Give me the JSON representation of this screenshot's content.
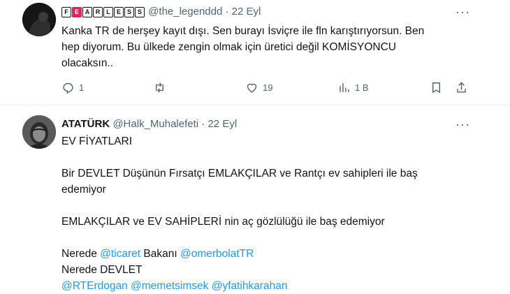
{
  "tweet1": {
    "display_name_badges": [
      "F",
      "E",
      "A",
      "R",
      "L",
      "E",
      "S",
      "S"
    ],
    "handle": "@the_legenddd",
    "separator": "·",
    "date": "22 Eyl",
    "more_icon": "ellipsis-icon",
    "lines": [
      "Kanka TR de herşey kayıt dışı. Sen burayı İsviçre ile fln karıştırıyorsun. Ben",
      "hep diyorum. Bu ülkede zengin olmak için üretici değil KOMİSYONCU",
      "olacaksın.."
    ],
    "actions": {
      "reply_count": "1",
      "retweet_count": "",
      "like_count": "19",
      "views_count": "1 B"
    }
  },
  "tweet2": {
    "display_name": "ATATÜRK",
    "handle": "@Halk_Muhalefeti",
    "separator": "·",
    "date": "22 Eyl",
    "para1": "EV FİYATLARI",
    "para2_line1": "Bir DEVLET Düşünün Fırsatçı EMLAKÇILAR ve Rantçı ev sahipleri ile baş",
    "para2_line2": "edemiyor",
    "para3": "EMLAKÇILAR ve EV SAHİPLERİ nin aç gözlülüğü ile baş edemiyor",
    "line4_prefix": "Nerede",
    "mention_ticaret": "@ticaret",
    "line4_middle": "Bakanı",
    "mention_omer": "@omerbolatTR",
    "line5": "Nerede DEVLET",
    "mention_rte": "@RTErdogan",
    "mention_memet": "@memetsimsek",
    "mention_yfatih": "@yfatihkarahan"
  }
}
